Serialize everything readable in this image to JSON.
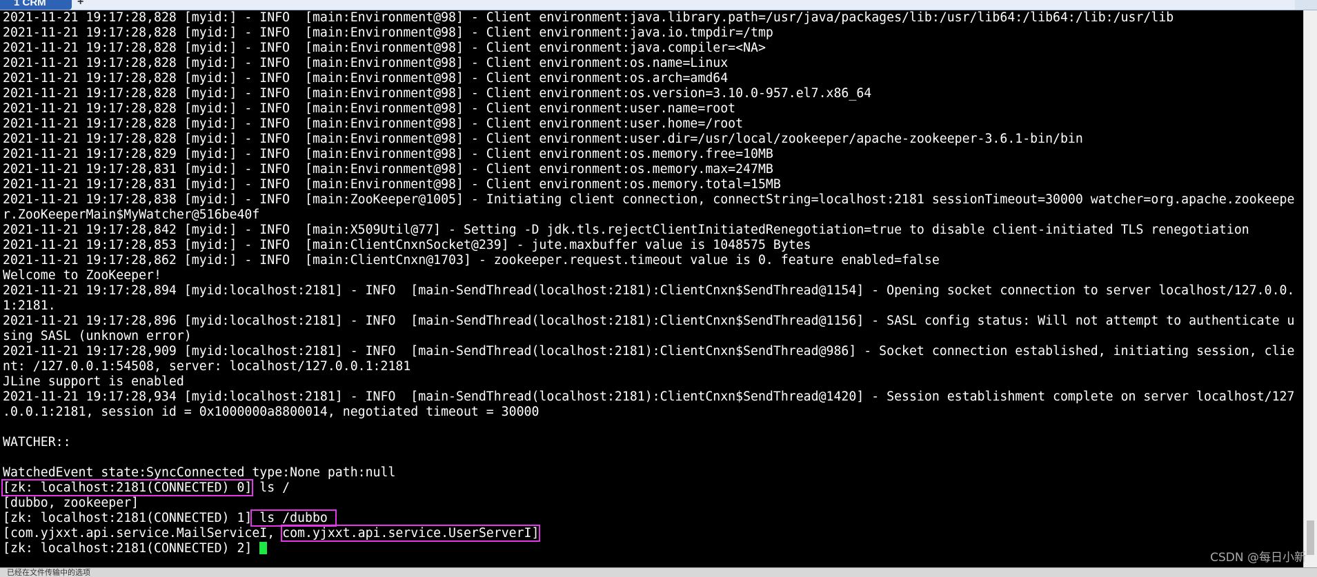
{
  "tabs": [
    {
      "label": "1 CRM"
    }
  ],
  "add_tab_label": "+",
  "terminal": {
    "lines": [
      "2021-11-21 19:17:28,828 [myid:] - INFO  [main:Environment@98] - Client environment:java.library.path=/usr/java/packages/lib:/usr/lib64:/lib64:/lib:/usr/lib",
      "2021-11-21 19:17:28,828 [myid:] - INFO  [main:Environment@98] - Client environment:java.io.tmpdir=/tmp",
      "2021-11-21 19:17:28,828 [myid:] - INFO  [main:Environment@98] - Client environment:java.compiler=<NA>",
      "2021-11-21 19:17:28,828 [myid:] - INFO  [main:Environment@98] - Client environment:os.name=Linux",
      "2021-11-21 19:17:28,828 [myid:] - INFO  [main:Environment@98] - Client environment:os.arch=amd64",
      "2021-11-21 19:17:28,828 [myid:] - INFO  [main:Environment@98] - Client environment:os.version=3.10.0-957.el7.x86_64",
      "2021-11-21 19:17:28,828 [myid:] - INFO  [main:Environment@98] - Client environment:user.name=root",
      "2021-11-21 19:17:28,828 [myid:] - INFO  [main:Environment@98] - Client environment:user.home=/root",
      "2021-11-21 19:17:28,828 [myid:] - INFO  [main:Environment@98] - Client environment:user.dir=/usr/local/zookeeper/apache-zookeeper-3.6.1-bin/bin",
      "2021-11-21 19:17:28,829 [myid:] - INFO  [main:Environment@98] - Client environment:os.memory.free=10MB",
      "2021-11-21 19:17:28,831 [myid:] - INFO  [main:Environment@98] - Client environment:os.memory.max=247MB",
      "2021-11-21 19:17:28,831 [myid:] - INFO  [main:Environment@98] - Client environment:os.memory.total=15MB",
      "2021-11-21 19:17:28,838 [myid:] - INFO  [main:ZooKeeper@1005] - Initiating client connection, connectString=localhost:2181 sessionTimeout=30000 watcher=org.apache.zookeepe",
      "r.ZooKeeperMain$MyWatcher@516be40f",
      "2021-11-21 19:17:28,842 [myid:] - INFO  [main:X509Util@77] - Setting -D jdk.tls.rejectClientInitiatedRenegotiation=true to disable client-initiated TLS renegotiation",
      "2021-11-21 19:17:28,853 [myid:] - INFO  [main:ClientCnxnSocket@239] - jute.maxbuffer value is 1048575 Bytes",
      "2021-11-21 19:17:28,862 [myid:] - INFO  [main:ClientCnxn@1703] - zookeeper.request.timeout value is 0. feature enabled=false",
      "Welcome to ZooKeeper!",
      "2021-11-21 19:17:28,894 [myid:localhost:2181] - INFO  [main-SendThread(localhost:2181):ClientCnxn$SendThread@1154] - Opening socket connection to server localhost/127.0.0.",
      "1:2181.",
      "2021-11-21 19:17:28,896 [myid:localhost:2181] - INFO  [main-SendThread(localhost:2181):ClientCnxn$SendThread@1156] - SASL config status: Will not attempt to authenticate u",
      "sing SASL (unknown error)",
      "2021-11-21 19:17:28,909 [myid:localhost:2181] - INFO  [main-SendThread(localhost:2181):ClientCnxn$SendThread@986] - Socket connection established, initiating session, clie",
      "nt: /127.0.0.1:54508, server: localhost/127.0.0.1:2181",
      "JLine support is enabled",
      "2021-11-21 19:17:28,934 [myid:localhost:2181] - INFO  [main-SendThread(localhost:2181):ClientCnxn$SendThread@1420] - Session establishment complete on server localhost/127",
      ".0.0.1:2181, session id = 0x1000000a8800014, negotiated timeout = 30000",
      "",
      "WATCHER::",
      "",
      "WatchedEvent state:SyncConnected type:None path:null"
    ],
    "prompt0": "[zk: localhost:2181(CONNECTED) 0]",
    "cmd0": " ls /",
    "out0": "[dubbo, zookeeper]",
    "prompt1": "[zk: localhost:2181(CONNECTED) 1]",
    "cmd1": " ls /dubbo ",
    "out1_pre": "[com.yjxxt.api.service.MailServiceI, ",
    "out1_hl": "com.yjxxt.api.service.UserServerI]",
    "prompt2": "[zk: localhost:2181(CONNECTED) 2]",
    "highlight_color": "#e437e8",
    "cursor_color": "#1ee842"
  },
  "statusbar": {
    "text": "已经在文件传输中的选项 "
  },
  "watermark": "CSDN @每日小新"
}
